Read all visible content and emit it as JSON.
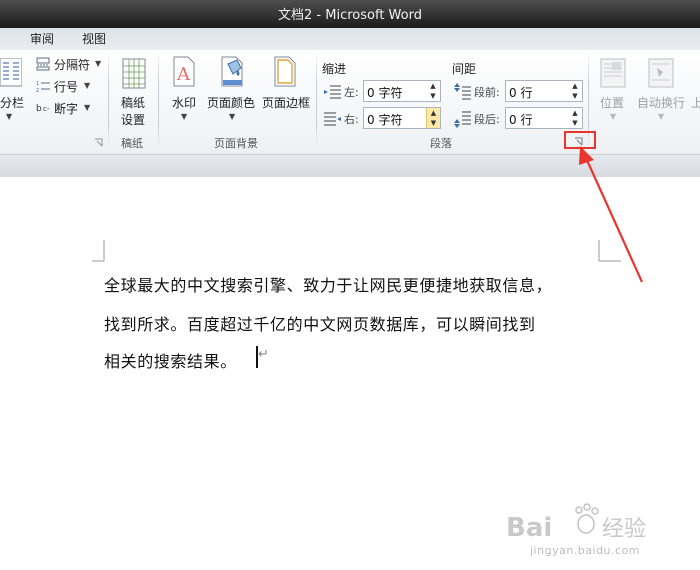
{
  "window": {
    "title": "文档2 - Microsoft Word"
  },
  "tabs": [
    "审阅",
    "视图"
  ],
  "ribbon": {
    "page_setup_partial": {
      "columns_label": "分栏",
      "breaks_label": "分隔符",
      "line_numbers_label": "行号",
      "hyphenation_label": "断字"
    },
    "manuscript": {
      "button_line1": "稿纸",
      "button_line2": "设置",
      "group_label": "稿纸"
    },
    "page_background": {
      "watermark_label": "水印",
      "page_color_label": "页面颜色",
      "page_borders_label": "页面边框",
      "group_label": "页面背景"
    },
    "paragraph": {
      "indent_header": "缩进",
      "indent_left_label": "左:",
      "indent_left_value": "0 字符",
      "indent_right_label": "右:",
      "indent_right_value": "0 字符",
      "spacing_header": "间距",
      "spacing_before_label": "段前:",
      "spacing_before_value": "0 行",
      "spacing_after_label": "段后:",
      "spacing_after_value": "0 行",
      "group_label": "段落"
    },
    "arrange_partial": {
      "position_label": "位置",
      "wrap_text_label": "自动换行",
      "bring_forward_partial": "上"
    }
  },
  "document": {
    "lines": [
      "全球最大的中文搜索引擎、致力于让网民更便捷地获取信息，",
      "找到所求。百度超过千亿的中文网页数据库，可以瞬间找到",
      "相关的搜索结果。"
    ]
  },
  "watermark": {
    "brand": "Baidu经验",
    "url": "jingyan.baidu.com"
  },
  "colors": {
    "annotation_red": "#e8352f",
    "highlight_spinner": "#fbe9a5"
  }
}
